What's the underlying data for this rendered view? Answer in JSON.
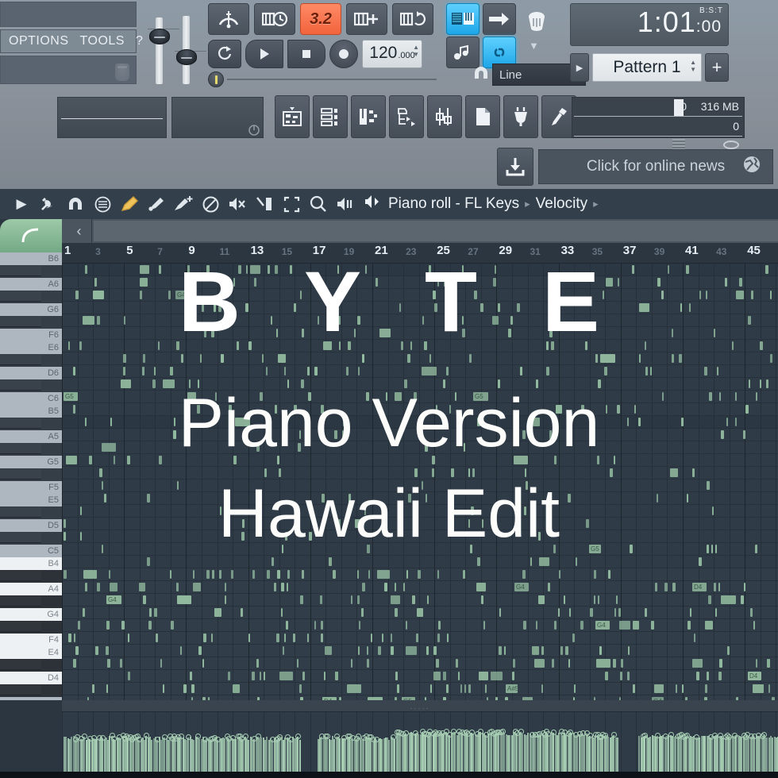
{
  "app": {
    "menu": {
      "items": [
        "OPTIONS",
        "TOOLS",
        "?"
      ]
    },
    "transport": {
      "tempo_value": "120",
      "tempo_decimals": ".000",
      "pattern_mode_label": "3.2",
      "buttons": [
        {
          "name": "metronome-button",
          "icon": "metronome-icon"
        },
        {
          "name": "wait-for-input-button",
          "icon": "clock-keyboard-icon"
        },
        {
          "name": "pattern-length-button",
          "icon": "3.2"
        },
        {
          "name": "add-pattern-button",
          "icon": "keyboard-plus-icon"
        },
        {
          "name": "loop-record-button",
          "icon": "keyboard-loop-icon"
        }
      ],
      "play_label": "play-icon",
      "stop_label": "stop-icon",
      "record_label": "record-icon",
      "loop_label": "pattern-song-toggle"
    },
    "snap": {
      "value": "Line",
      "typing_mode": "on",
      "link_mode": "on"
    },
    "time": {
      "primary": "1:01",
      "secondary": "00",
      "format_label": "B:S:T"
    },
    "pattern": {
      "name": "Pattern 1",
      "add_label": "+"
    },
    "status": {
      "cpu_value": "0",
      "memory_value": "316 MB",
      "voices_value": "0"
    },
    "news": {
      "text_plain": "Click for ",
      "text_bold": "online news",
      "full": "Click for online news"
    }
  },
  "piano_roll": {
    "breadcrumb": {
      "title": "Piano roll - FL Keys",
      "section": "Velocity",
      "separator": "▸"
    },
    "tools": [
      {
        "name": "menu-arrow-icon",
        "glyph": "▸"
      },
      {
        "name": "wrench-icon",
        "glyph": "ᵍ"
      },
      {
        "name": "magnet-icon",
        "glyph": "∩"
      },
      {
        "name": "list-icon",
        "glyph": "≡"
      },
      {
        "name": "draw-pencil-icon",
        "glyph": "✎"
      },
      {
        "name": "paint-brush-icon",
        "glyph": "✏"
      },
      {
        "name": "paint-add-icon",
        "glyph": "✚"
      },
      {
        "name": "delete-icon",
        "glyph": "⊘"
      },
      {
        "name": "mute-icon",
        "glyph": "✕"
      },
      {
        "name": "slice-icon",
        "glyph": "✂"
      },
      {
        "name": "select-icon",
        "glyph": "⬚"
      },
      {
        "name": "zoom-icon",
        "glyph": "⚲"
      },
      {
        "name": "playback-icon",
        "glyph": "⏸"
      }
    ],
    "back_label": "‹",
    "bars": [
      {
        "label": "1",
        "dim": false
      },
      {
        "label": "3",
        "dim": true
      },
      {
        "label": "5",
        "dim": false
      },
      {
        "label": "7",
        "dim": true
      },
      {
        "label": "9",
        "dim": false
      },
      {
        "label": "11",
        "dim": true
      },
      {
        "label": "13",
        "dim": false
      },
      {
        "label": "15",
        "dim": true
      },
      {
        "label": "17",
        "dim": false
      },
      {
        "label": "19",
        "dim": true
      },
      {
        "label": "21",
        "dim": false
      },
      {
        "label": "23",
        "dim": true
      },
      {
        "label": "25",
        "dim": false
      },
      {
        "label": "27",
        "dim": true
      },
      {
        "label": "29",
        "dim": false
      },
      {
        "label": "31",
        "dim": true
      },
      {
        "label": "33",
        "dim": false
      },
      {
        "label": "35",
        "dim": true
      },
      {
        "label": "37",
        "dim": false
      },
      {
        "label": "39",
        "dim": true
      },
      {
        "label": "41",
        "dim": false
      },
      {
        "label": "43",
        "dim": true
      },
      {
        "label": "45",
        "dim": false
      }
    ],
    "keys": [
      {
        "note": "B6",
        "black": false,
        "label": true
      },
      {
        "note": "A#6",
        "black": true,
        "label": false
      },
      {
        "note": "A6",
        "black": false,
        "label": true
      },
      {
        "note": "G#6",
        "black": true,
        "label": false
      },
      {
        "note": "G6",
        "black": false,
        "label": true
      },
      {
        "note": "F#6",
        "black": true,
        "label": false
      },
      {
        "note": "F6",
        "black": false,
        "label": true
      },
      {
        "note": "E6",
        "black": false,
        "label": true
      },
      {
        "note": "D#6",
        "black": true,
        "label": false
      },
      {
        "note": "D6",
        "black": false,
        "label": true
      },
      {
        "note": "C#6",
        "black": true,
        "label": false
      },
      {
        "note": "C6",
        "black": false,
        "label": true
      },
      {
        "note": "B5",
        "black": false,
        "label": true
      },
      {
        "note": "A#5",
        "black": true,
        "label": false
      },
      {
        "note": "A5",
        "black": false,
        "label": true
      },
      {
        "note": "G#5",
        "black": true,
        "label": false
      },
      {
        "note": "G5",
        "black": false,
        "label": true
      },
      {
        "note": "F#5",
        "black": true,
        "label": false
      },
      {
        "note": "F5",
        "black": false,
        "label": true
      },
      {
        "note": "E5",
        "black": false,
        "label": true
      },
      {
        "note": "D#5",
        "black": true,
        "label": false
      },
      {
        "note": "D5",
        "black": false,
        "label": true
      },
      {
        "note": "C#5",
        "black": true,
        "label": false
      },
      {
        "note": "C5",
        "black": false,
        "label": true
      },
      {
        "note": "B4",
        "black": false,
        "label": true
      },
      {
        "note": "A#4",
        "black": true,
        "label": false
      },
      {
        "note": "A4",
        "black": false,
        "label": true
      },
      {
        "note": "G#4",
        "black": true,
        "label": false
      },
      {
        "note": "G4",
        "black": false,
        "label": true
      },
      {
        "note": "F#4",
        "black": true,
        "label": false
      },
      {
        "note": "F4",
        "black": false,
        "label": true
      },
      {
        "note": "E4",
        "black": false,
        "label": true
      },
      {
        "note": "D#4",
        "black": true,
        "label": false
      },
      {
        "note": "D4",
        "black": false,
        "label": true
      },
      {
        "note": "C#4",
        "black": true,
        "label": false
      }
    ],
    "note_label_examples": [
      "D6",
      "G5",
      "A5",
      "A#5",
      "G4",
      "D4"
    ],
    "velocity_label": "Velocity"
  },
  "overlay": {
    "title": "B Y T E",
    "subtitle_1": "Piano Version",
    "subtitle_2": "Hawaii Edit"
  },
  "colors": {
    "note_green": "#93bb9f",
    "accent_blue": "#29a8e8",
    "accent_orange": "#f2643c",
    "grid_bg": "#2f3c48",
    "chrome_bg": "#8e9ba6"
  }
}
